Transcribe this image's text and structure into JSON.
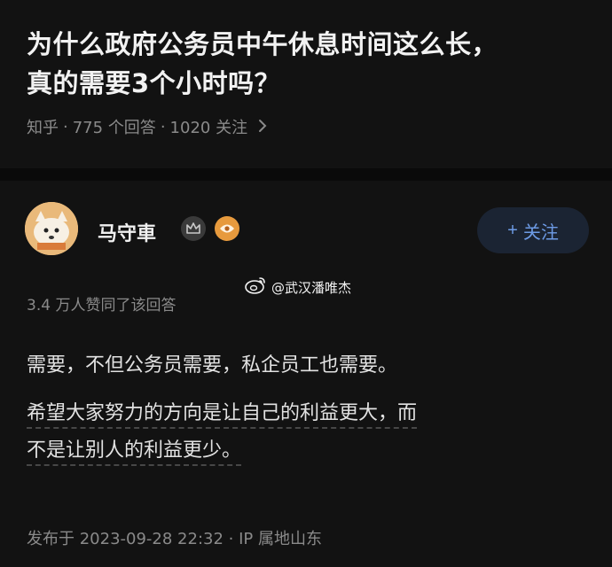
{
  "question": {
    "title_line1": "为什么政府公务员中午休息时间这么长，",
    "title_line2": "真的需要3个小时吗？",
    "meta": {
      "source": "知乎",
      "answers": "775 个回答",
      "followers": "1020 关注",
      "separator": "·"
    }
  },
  "author": {
    "name": "马守車",
    "follow_label": "关注",
    "follow_plus": "+"
  },
  "watermark": {
    "text": "@武汉潘唯杰"
  },
  "answer": {
    "upvote_note": "3.4 万人赞同了该回答",
    "paragraph1": "需要，不但公务员需要，私企员工也需要。",
    "paragraph2_line1": "希望大家努力的方向是让自己的利益更大，而",
    "paragraph2_line2": "不是让别人的利益更少。",
    "posted": "发布于 2023-09-28 22:32 · IP 属地山东"
  },
  "colors": {
    "background": "#121212",
    "accent_blue": "#6d9be6",
    "muted_text": "#8a8a8a"
  },
  "icons": {
    "chevron": "chevron-right-icon",
    "crown_badge": "crown-badge-icon",
    "eye_badge": "eye-badge-icon",
    "weibo": "weibo-icon"
  }
}
